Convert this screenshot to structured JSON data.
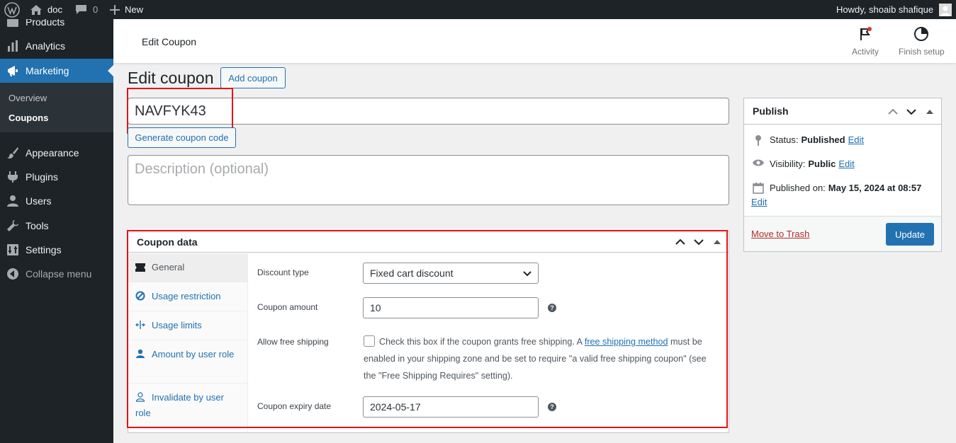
{
  "adminbar": {
    "site_name": "doc",
    "comments_count": "0",
    "new_label": "New",
    "howdy": "Howdy, shoaib shafique"
  },
  "sidebar": {
    "items": [
      {
        "label": "Products",
        "icon": "archive-icon"
      },
      {
        "label": "Analytics",
        "icon": "bar-chart-icon"
      },
      {
        "label": "Marketing",
        "icon": "megaphone-icon"
      },
      {
        "label": "Appearance",
        "icon": "brush-icon"
      },
      {
        "label": "Plugins",
        "icon": "plug-icon"
      },
      {
        "label": "Users",
        "icon": "user-icon"
      },
      {
        "label": "Tools",
        "icon": "wrench-icon"
      },
      {
        "label": "Settings",
        "icon": "sliders-icon"
      },
      {
        "label": "Collapse menu",
        "icon": "collapse-icon"
      }
    ],
    "submenu": [
      {
        "label": "Overview"
      },
      {
        "label": "Coupons"
      }
    ]
  },
  "header": {
    "title": "Edit Coupon",
    "activity_label": "Activity",
    "finish_setup_label": "Finish setup"
  },
  "main": {
    "page_title": "Edit coupon",
    "add_coupon_label": "Add coupon",
    "coupon_code": "NAVFYK43",
    "generate_label": "Generate coupon code",
    "description_placeholder": "Description (optional)"
  },
  "coupon_data": {
    "title": "Coupon data",
    "tabs": [
      {
        "label": "General"
      },
      {
        "label": "Usage restriction"
      },
      {
        "label": "Usage limits"
      },
      {
        "label": "Amount by user role"
      },
      {
        "label": "Invalidate by user role"
      }
    ],
    "discount_type_label": "Discount type",
    "discount_type_value": "Fixed cart discount",
    "coupon_amount_label": "Coupon amount",
    "coupon_amount_value": "10",
    "free_shipping_label": "Allow free shipping",
    "free_shipping_text_1": "Check this box if the coupon grants free shipping. A ",
    "free_shipping_link": "free shipping method",
    "free_shipping_text_2": " must be enabled in your shipping zone and be set to require \"a valid free shipping coupon\" (see the \"Free Shipping Requires\" setting).",
    "expiry_label": "Coupon expiry date",
    "expiry_value": "2024-05-17"
  },
  "publish": {
    "title": "Publish",
    "status_label": "Status:",
    "status_value": "Published",
    "visibility_label": "Visibility:",
    "visibility_value": "Public",
    "published_label": "Published on:",
    "published_value": "May 15, 2024 at 08:57",
    "edit_label": "Edit",
    "trash_label": "Move to Trash",
    "update_label": "Update"
  },
  "colors": {
    "accent": "#2271b1",
    "sidebar_bg": "#1d2327",
    "highlight_box": "#e5131a"
  }
}
